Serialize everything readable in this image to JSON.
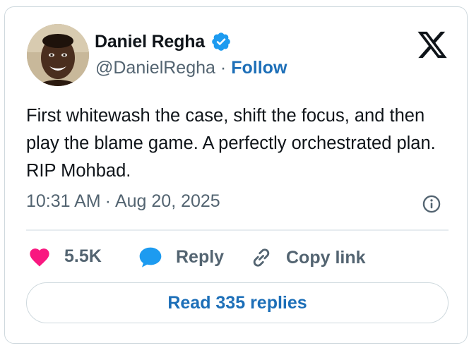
{
  "author": {
    "name": "Daniel Regha",
    "handle": "@DanielRegha",
    "separator": "·",
    "follow_label": "Follow",
    "verified": true
  },
  "tweet": {
    "text": "First whitewash the case, shift the focus, and then play the blame game. A perfectly orchestrated plan. RIP Mohbad.",
    "time": "10:31 AM",
    "date": "Aug 20, 2025",
    "separator": "·"
  },
  "actions": {
    "likes": "5.5K",
    "reply_label": "Reply",
    "copy_label": "Copy link"
  },
  "read_replies_label": "Read 335 replies",
  "icons": {
    "brand": "x-logo-icon",
    "verified": "verified-badge-icon",
    "info": "info-icon",
    "like": "heart-icon",
    "reply": "speech-bubble-icon",
    "copy": "link-icon"
  },
  "colors": {
    "accent": "#1d6fb8",
    "verified": "#1d9bf0",
    "heart": "#f91880",
    "muted": "#536471",
    "text": "#0f1419",
    "border": "#cfd9de"
  }
}
